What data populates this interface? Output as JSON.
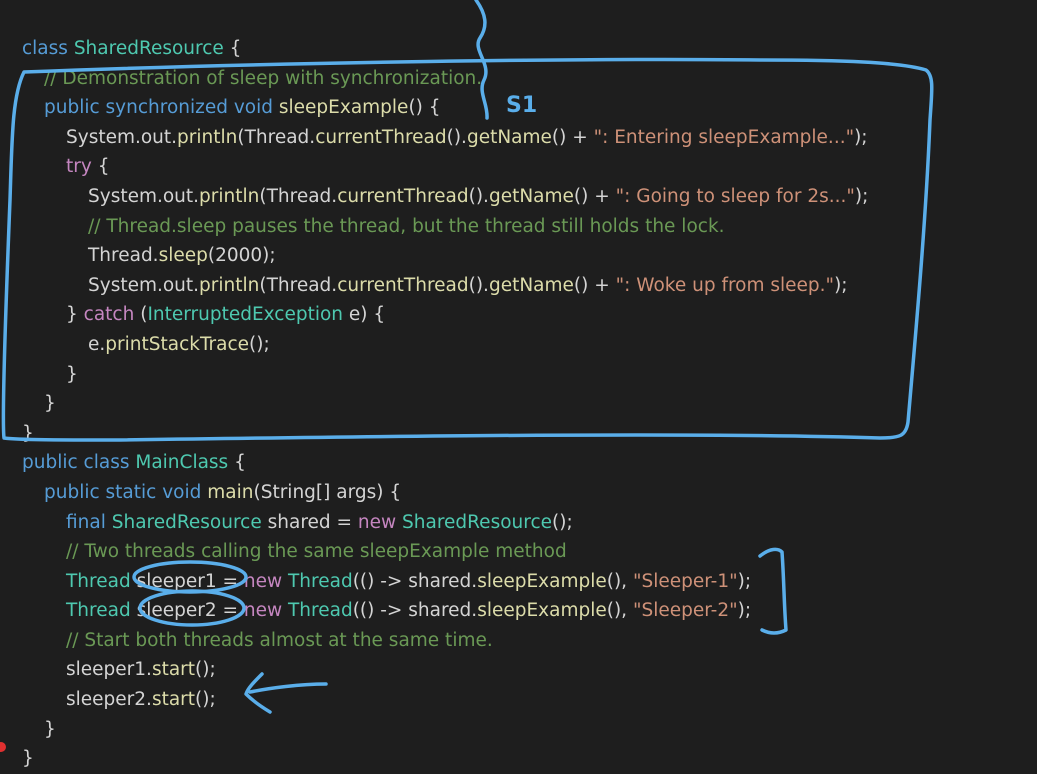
{
  "code": {
    "lines": [
      {
        "indent": 0,
        "tokens": [
          [
            "kw",
            "class "
          ],
          [
            "ty",
            "SharedResource"
          ],
          [
            "tx",
            " {"
          ]
        ]
      },
      {
        "indent": 1,
        "tokens": [
          [
            "cm",
            "// Demonstration of sleep with synchronization."
          ]
        ]
      },
      {
        "indent": 1,
        "tokens": [
          [
            "kw",
            "public synchronized void "
          ],
          [
            "fn",
            "sleepExample"
          ],
          [
            "tx",
            "() {"
          ]
        ]
      },
      {
        "indent": 2,
        "tokens": [
          [
            "tx",
            "System.out."
          ],
          [
            "fn",
            "println"
          ],
          [
            "tx",
            "(Thread."
          ],
          [
            "fn",
            "currentThread"
          ],
          [
            "tx",
            "()."
          ],
          [
            "fn",
            "getName"
          ],
          [
            "tx",
            "() + "
          ],
          [
            "str",
            "\": Entering sleepExample...\""
          ],
          [
            "tx",
            ");"
          ]
        ]
      },
      {
        "indent": 2,
        "tokens": [
          [
            "kw2",
            "try"
          ],
          [
            "tx",
            " {"
          ]
        ]
      },
      {
        "indent": 3,
        "tokens": [
          [
            "tx",
            "System.out."
          ],
          [
            "fn",
            "println"
          ],
          [
            "tx",
            "(Thread."
          ],
          [
            "fn",
            "currentThread"
          ],
          [
            "tx",
            "()."
          ],
          [
            "fn",
            "getName"
          ],
          [
            "tx",
            "() + "
          ],
          [
            "str",
            "\": Going to sleep for 2s...\""
          ],
          [
            "tx",
            ");"
          ]
        ]
      },
      {
        "indent": 3,
        "tokens": [
          [
            "cm",
            "// Thread.sleep pauses the thread, but the thread still holds the lock."
          ]
        ]
      },
      {
        "indent": 3,
        "tokens": [
          [
            "tx",
            "Thread."
          ],
          [
            "fn",
            "sleep"
          ],
          [
            "tx",
            "(2000);"
          ]
        ]
      },
      {
        "indent": 3,
        "tokens": [
          [
            "tx",
            "System.out."
          ],
          [
            "fn",
            "println"
          ],
          [
            "tx",
            "(Thread."
          ],
          [
            "fn",
            "currentThread"
          ],
          [
            "tx",
            "()."
          ],
          [
            "fn",
            "getName"
          ],
          [
            "tx",
            "() + "
          ],
          [
            "str",
            "\": Woke up from sleep.\""
          ],
          [
            "tx",
            ");"
          ]
        ]
      },
      {
        "indent": 2,
        "tokens": [
          [
            "tx",
            "} "
          ],
          [
            "kw2",
            "catch"
          ],
          [
            "tx",
            " ("
          ],
          [
            "ty",
            "InterruptedException"
          ],
          [
            "tx",
            " e) {"
          ]
        ]
      },
      {
        "indent": 3,
        "tokens": [
          [
            "tx",
            "e."
          ],
          [
            "fn",
            "printStackTrace"
          ],
          [
            "tx",
            "();"
          ]
        ]
      },
      {
        "indent": 2,
        "tokens": [
          [
            "tx",
            "}"
          ]
        ]
      },
      {
        "indent": 1,
        "tokens": [
          [
            "tx",
            "}"
          ]
        ]
      },
      {
        "indent": 0,
        "tokens": [
          [
            "tx",
            "}"
          ]
        ]
      },
      {
        "indent": 0,
        "tokens": [
          [
            "kw",
            "public class "
          ],
          [
            "ty",
            "MainClass"
          ],
          [
            "tx",
            " {"
          ]
        ]
      },
      {
        "indent": 1,
        "tokens": [
          [
            "kw",
            "public static void "
          ],
          [
            "fn",
            "main"
          ],
          [
            "tx",
            "(String[] args) {"
          ]
        ]
      },
      {
        "indent": 2,
        "tokens": [
          [
            "kw",
            "final "
          ],
          [
            "ty",
            "SharedResource"
          ],
          [
            "tx",
            " shared = "
          ],
          [
            "kw2",
            "new "
          ],
          [
            "ty",
            "SharedResource"
          ],
          [
            "tx",
            "();"
          ]
        ]
      },
      {
        "indent": 2,
        "tokens": [
          [
            "cm",
            "// Two threads calling the same sleepExample method"
          ]
        ]
      },
      {
        "indent": 2,
        "tokens": [
          [
            "ty",
            "Thread"
          ],
          [
            "tx",
            " sleeper1 = "
          ],
          [
            "kw2",
            "new "
          ],
          [
            "ty",
            "Thread"
          ],
          [
            "tx",
            "(() -> shared."
          ],
          [
            "fn",
            "sleepExample"
          ],
          [
            "tx",
            "(), "
          ],
          [
            "str",
            "\"Sleeper-1\""
          ],
          [
            "tx",
            ");"
          ]
        ]
      },
      {
        "indent": 2,
        "tokens": [
          [
            "ty",
            "Thread"
          ],
          [
            "tx",
            " sleeper2 = "
          ],
          [
            "kw2",
            "new "
          ],
          [
            "ty",
            "Thread"
          ],
          [
            "tx",
            "(() -> shared."
          ],
          [
            "fn",
            "sleepExample"
          ],
          [
            "tx",
            "(), "
          ],
          [
            "str",
            "\"Sleeper-2\""
          ],
          [
            "tx",
            ");"
          ]
        ]
      },
      {
        "indent": 2,
        "tokens": [
          [
            "cm",
            "// Start both threads almost at the same time."
          ]
        ]
      },
      {
        "indent": 2,
        "tokens": [
          [
            "tx",
            "sleeper1."
          ],
          [
            "fn",
            "start"
          ],
          [
            "tx",
            "();"
          ]
        ]
      },
      {
        "indent": 2,
        "tokens": [
          [
            "tx",
            "sleeper2."
          ],
          [
            "fn",
            "start"
          ],
          [
            "tx",
            "();"
          ]
        ]
      },
      {
        "indent": 1,
        "tokens": [
          [
            "tx",
            "}"
          ]
        ]
      },
      {
        "indent": 0,
        "tokens": [
          [
            "tx",
            "}"
          ]
        ]
      }
    ]
  },
  "annotations": {
    "note_text": "S1",
    "ink_color": "#5aaeea"
  }
}
